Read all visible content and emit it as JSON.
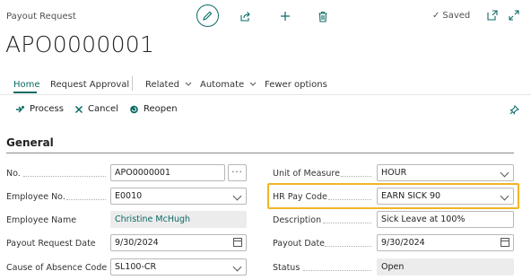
{
  "header": {
    "page_label": "Payout Request",
    "record_title": "APO0000001",
    "saved_label": "Saved",
    "saved_check": "✓"
  },
  "toolbar_icons": [
    "edit-icon",
    "share-icon",
    "new-icon",
    "delete-icon",
    "open-new-window-icon",
    "expand-icon"
  ],
  "nav": {
    "home": "Home",
    "request_approval": "Request Approval",
    "related": "Related",
    "automate": "Automate",
    "fewer_options": "Fewer options"
  },
  "actions": {
    "process": "Process",
    "cancel": "Cancel",
    "reopen": "Reopen"
  },
  "section_title": "General",
  "fields_left": {
    "no": {
      "label": "No.",
      "value": "APO0000001"
    },
    "employee_no": {
      "label": "Employee No.",
      "value": "E0010"
    },
    "employee_name": {
      "label": "Employee Name",
      "value": "Christine McHugh"
    },
    "payout_request_date": {
      "label": "Payout Request Date",
      "value": "9/30/2024"
    },
    "cause_of_absence": {
      "label": "Cause of Absence Code",
      "value": "SL100-CR"
    }
  },
  "fields_right": {
    "unit_of_measure": {
      "label": "Unit of Measure",
      "value": "HOUR"
    },
    "hr_pay_code": {
      "label": "HR Pay Code",
      "value": "EARN SICK 90"
    },
    "description": {
      "label": "Description",
      "value": "Sick Leave at 100%"
    },
    "payout_date": {
      "label": "Payout Date",
      "value": "9/30/2024"
    },
    "status": {
      "label": "Status",
      "value": "Open"
    }
  },
  "colors": {
    "accent": "#0b6a63",
    "highlight": "#f2b425",
    "readonly_bg": "#ececec"
  }
}
